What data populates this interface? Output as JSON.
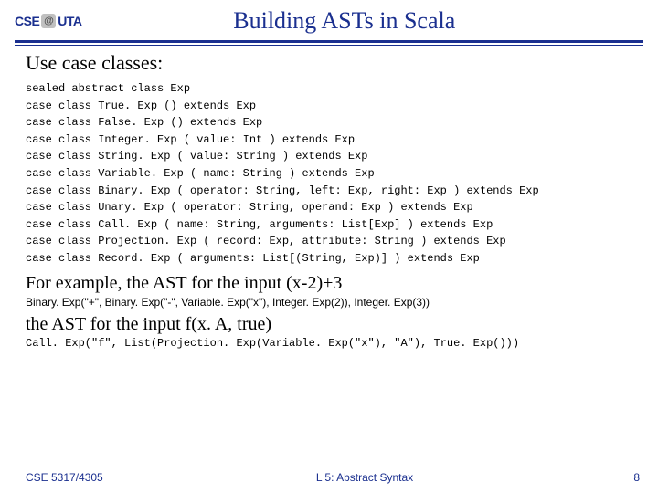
{
  "logo": {
    "left": "CSE",
    "right": "UTA",
    "at": "@"
  },
  "title": "Building ASTs in Scala",
  "subhead": "Use case classes:",
  "code": [
    "sealed abstract class Exp",
    "case class True. Exp () extends Exp",
    "case class False. Exp () extends Exp",
    "case class Integer. Exp ( value: Int ) extends Exp",
    "case class String. Exp ( value: String ) extends Exp",
    "case class Variable. Exp ( name: String ) extends Exp",
    "case class Binary. Exp ( operator: String, left: Exp, right: Exp ) extends Exp",
    "case class Unary. Exp ( operator: String, operand: Exp ) extends Exp",
    "case class Call. Exp ( name: String, arguments: List[Exp] ) extends Exp",
    "case class Projection. Exp ( record: Exp, attribute: String ) extends Exp",
    "case class Record. Exp ( arguments: List[(String, Exp)] ) extends Exp"
  ],
  "body1": "For example, the AST for the input    (x-2)+3",
  "example1": "Binary. Exp(\"+\", Binary. Exp(\"-\", Variable. Exp(\"x\"), Integer. Exp(2)), Integer. Exp(3))",
  "body2": "the AST for the input   f(x. A, true)",
  "example2": "Call. Exp(\"f\", List(Projection. Exp(Variable. Exp(\"x\"), \"A\"), True. Exp()))",
  "footer": {
    "left": "CSE 5317/4305",
    "center": "L 5: Abstract Syntax",
    "page": "8"
  }
}
